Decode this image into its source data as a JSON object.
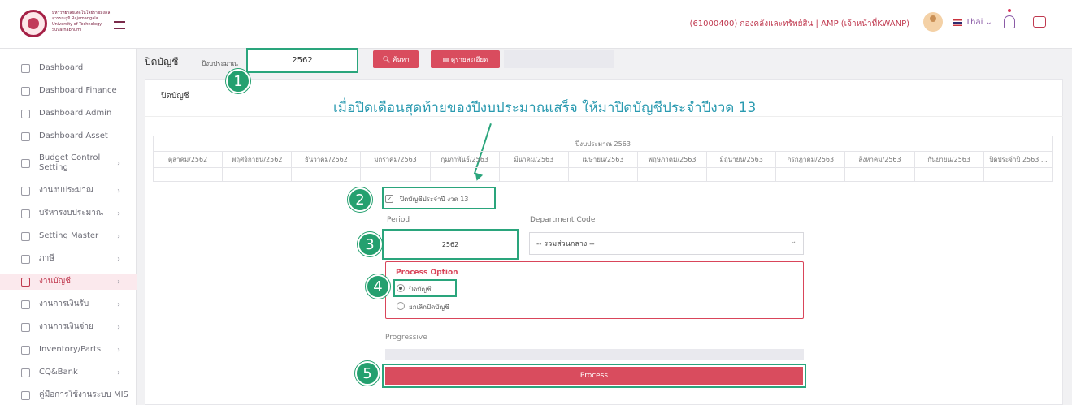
{
  "header": {
    "university_name": "มหาวิทยาลัยเทคโนโลยีราชมงคลสุวรรณภูมิ Rajamangala University of Technology Suvarnabhumi",
    "user_info": "(61000400) กองคลังและทรัพย์สิน | AMP (เจ้าหน้าที่KWANP)",
    "language": "Thai",
    "icons": {
      "logo": "university-seal",
      "menu": "hamburger-icon",
      "avatar": "user-avatar",
      "flag": "thai-flag",
      "bell": "bell-icon",
      "chat": "chat-icon"
    }
  },
  "sidebar": {
    "items": [
      {
        "label": "Dashboard",
        "icon": "chart-icon",
        "has_chevron": false,
        "active": false
      },
      {
        "label": "Dashboard Finance",
        "icon": "chart-icon",
        "has_chevron": false,
        "active": false
      },
      {
        "label": "Dashboard Admin",
        "icon": "chart-icon",
        "has_chevron": false,
        "active": false
      },
      {
        "label": "Dashboard Asset",
        "icon": "chart-icon",
        "has_chevron": false,
        "active": false
      },
      {
        "label": "Budget Control Setting",
        "icon": "gear-icon",
        "has_chevron": true,
        "active": false
      },
      {
        "label": "งานงบประมาณ",
        "icon": "folder-icon",
        "has_chevron": true,
        "active": false
      },
      {
        "label": "บริหารงบประมาณ",
        "icon": "stack-icon",
        "has_chevron": true,
        "active": false
      },
      {
        "label": "Setting Master",
        "icon": "settings-icon",
        "has_chevron": true,
        "active": false
      },
      {
        "label": "ภาษี",
        "icon": "stack-icon",
        "has_chevron": true,
        "active": false
      },
      {
        "label": "งานบัญชี",
        "icon": "folder-icon",
        "has_chevron": true,
        "active": true
      },
      {
        "label": "งานการเงินรับ",
        "icon": "hand-icon",
        "has_chevron": true,
        "active": false
      },
      {
        "label": "งานการเงินจ่าย",
        "icon": "wallet-icon",
        "has_chevron": true,
        "active": false
      },
      {
        "label": "Inventory/Parts",
        "icon": "box-icon",
        "has_chevron": true,
        "active": false
      },
      {
        "label": "CQ&Bank",
        "icon": "check-icon",
        "has_chevron": true,
        "active": false
      },
      {
        "label": "คู่มือการใช้งานระบบ MIS",
        "icon": "book-icon",
        "has_chevron": false,
        "active": false
      }
    ]
  },
  "toolbar": {
    "page_title": "ปิดบัญชี",
    "year_label": "ปีงบประมาณ",
    "year_value": "2562",
    "search_label": "ค้นหา",
    "detail_label": "ดูรายละเอียด"
  },
  "card": {
    "title": "ปิดบัญชี",
    "annotation": "เมื่อปิดเดือนสุดท้ายของปีงบประมาณเสร็จ ให้มาปิดบัญชีประจำปีงวด 13"
  },
  "months_table": {
    "year_header": "ปีงบประมาณ 2563",
    "months": [
      "ตุลาคม/2562",
      "พฤศจิกายน/2562",
      "ธันวาคม/2562",
      "มกราคม/2563",
      "กุมภาพันธ์/2563",
      "มีนาคม/2563",
      "เมษายน/2563",
      "พฤษภาคม/2563",
      "มิถุนายน/2563",
      "กรกฎาคม/2563",
      "สิงหาคม/2563",
      "กันยายน/2563",
      "ปิดประจำปี 2563 ..."
    ]
  },
  "form": {
    "close_year_checkbox": {
      "label": "ปิดบัญชีประจำปี งวด 13",
      "checked": true
    },
    "period_label": "Period",
    "period_value": "2562",
    "department_label": "Department Code",
    "department_value": "-- รวมส่วนกลาง --",
    "process_option_label": "Process Option",
    "options": [
      {
        "label": "ปิดบัญชี",
        "selected": true
      },
      {
        "label": "ยกเลิกปิดบัญชี",
        "selected": false
      }
    ],
    "progressive_label": "Progressive",
    "progress": 0,
    "process_button": "Process"
  },
  "steps": [
    "1",
    "2",
    "3",
    "4",
    "5"
  ],
  "colors": {
    "accent": "#d94c5e",
    "annotation_green": "#24a06f",
    "annotation_text": "#2a9ab0"
  }
}
